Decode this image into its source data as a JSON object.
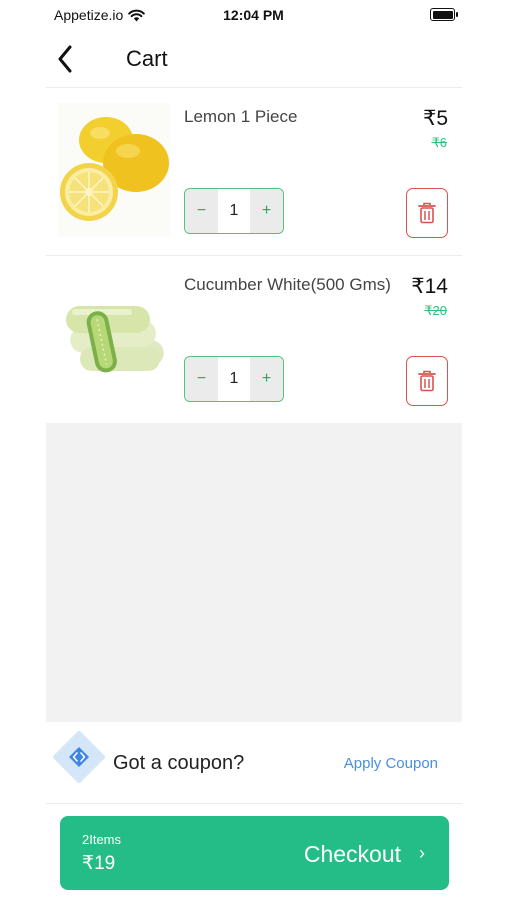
{
  "status_bar": {
    "carrier": "Appetize.io",
    "time": "12:04 PM"
  },
  "header": {
    "title": "Cart"
  },
  "cart": {
    "items": [
      {
        "name": "Lemon 1 Piece",
        "price": "₹5",
        "mrp": "₹6",
        "quantity": "1",
        "decrement": "−",
        "increment": "+"
      },
      {
        "name": "Cucumber White(500 Gms)",
        "price": "₹14",
        "mrp": "₹20",
        "quantity": "1",
        "decrement": "−",
        "increment": "+"
      }
    ]
  },
  "coupon": {
    "text": "Got a coupon?",
    "action": "Apply Coupon"
  },
  "checkout": {
    "items_count": "2Items",
    "total": "₹19",
    "label": "Checkout",
    "chevron": "›"
  },
  "colors": {
    "accent_green": "#25bd87",
    "stepper_border": "#55c079",
    "delete_red": "#d9534f",
    "link_blue": "#4a8fe0"
  },
  "icons": {
    "back": "chevron-left-icon",
    "wifi": "wifi-icon",
    "battery": "battery-icon",
    "delete": "trash-icon",
    "coupon": "coupon-diamond-icon"
  }
}
